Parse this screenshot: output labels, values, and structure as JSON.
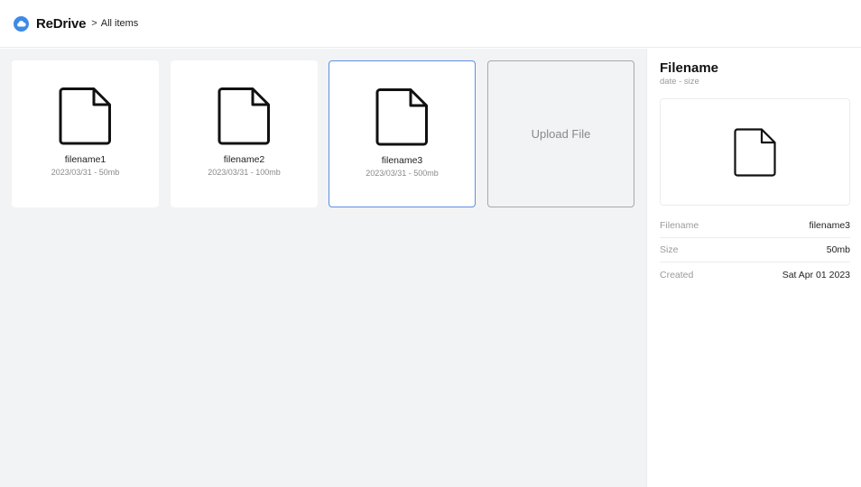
{
  "header": {
    "brand": "ReDrive",
    "separator": ">",
    "breadcrumb": "All items",
    "logo_icon": "cloud-icon",
    "accent_color": "#3f8ae6"
  },
  "files": [
    {
      "name": "filename1",
      "meta": "2023/03/31 - 50mb",
      "icon": "file-icon",
      "selected": false
    },
    {
      "name": "filename2",
      "meta": "2023/03/31 - 100mb",
      "icon": "file-icon",
      "selected": false
    },
    {
      "name": "filename3",
      "meta": "2023/03/31 - 500mb",
      "icon": "file-icon",
      "selected": true
    }
  ],
  "upload": {
    "label": "Upload File"
  },
  "details": {
    "title": "Filename",
    "subtitle": "date - size",
    "preview_icon": "file-icon",
    "properties": [
      {
        "key": "Filename",
        "value": "filename3"
      },
      {
        "key": "Size",
        "value": "50mb"
      },
      {
        "key": "Created",
        "value": "Sat Apr 01 2023"
      }
    ]
  },
  "colors": {
    "selected_border": "#5b8ee0",
    "content_background": "#f2f3f5"
  }
}
